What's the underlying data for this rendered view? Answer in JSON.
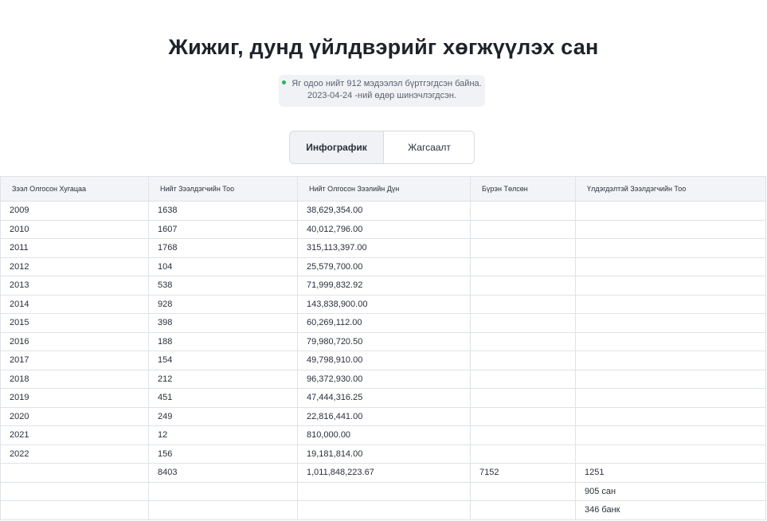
{
  "page": {
    "title": "Жижиг, дунд үйлдвэрийг хөгжүүлэх сан",
    "notice_line1": "Яг одоо нийт 912 мэдээлэл бүртгэгдсэн байна.",
    "notice_line2": "2023-04-24 -ний өдөр шинэчлэгдсэн."
  },
  "tabs": [
    {
      "label": "Инфографик",
      "active": true
    },
    {
      "label": "Жагсаалт",
      "active": false
    }
  ],
  "table": {
    "headers": [
      "Зээл Олгосон Хугацаа",
      "Нийт Зээлдэгчийн Тоо",
      "Нийт Олгосон Зээлийн Дүн",
      "Бүрэн Төлсөн",
      "Үлдэгдэлтэй Зээлдэгчийн Тоо"
    ],
    "rows": [
      [
        "2009",
        "1638",
        "38,629,354.00",
        "",
        ""
      ],
      [
        "2010",
        "1607",
        "40,012,796.00",
        "",
        ""
      ],
      [
        "2011",
        "1768",
        "315,113,397.00",
        "",
        ""
      ],
      [
        "2012",
        "104",
        "25,579,700.00",
        "",
        ""
      ],
      [
        "2013",
        "538",
        "71,999,832.92",
        "",
        ""
      ],
      [
        "2014",
        "928",
        "143,838,900.00",
        "",
        ""
      ],
      [
        "2015",
        "398",
        "60,269,112.00",
        "",
        ""
      ],
      [
        "2016",
        "188",
        "79,980,720.50",
        "",
        ""
      ],
      [
        "2017",
        "154",
        "49,798,910.00",
        "",
        ""
      ],
      [
        "2018",
        "212",
        "96,372,930.00",
        "",
        ""
      ],
      [
        "2019",
        "451",
        "47,444,316.25",
        "",
        ""
      ],
      [
        "2020",
        "249",
        "22,816,441.00",
        "",
        ""
      ],
      [
        "2021",
        "12",
        "810,000.00",
        "",
        ""
      ],
      [
        "2022",
        "156",
        "19,181,814.00",
        "",
        ""
      ],
      [
        "",
        "8403",
        "1,011,848,223.67",
        "7152",
        "1251"
      ],
      [
        "",
        "",
        "",
        "",
        "905 сан"
      ],
      [
        "",
        "",
        "",
        "",
        "346 банк"
      ]
    ]
  },
  "colors": {
    "status_dot": "#22b55f",
    "header_bg": "#f3f4f7",
    "active_tab_bg": "#f1f2f5"
  }
}
